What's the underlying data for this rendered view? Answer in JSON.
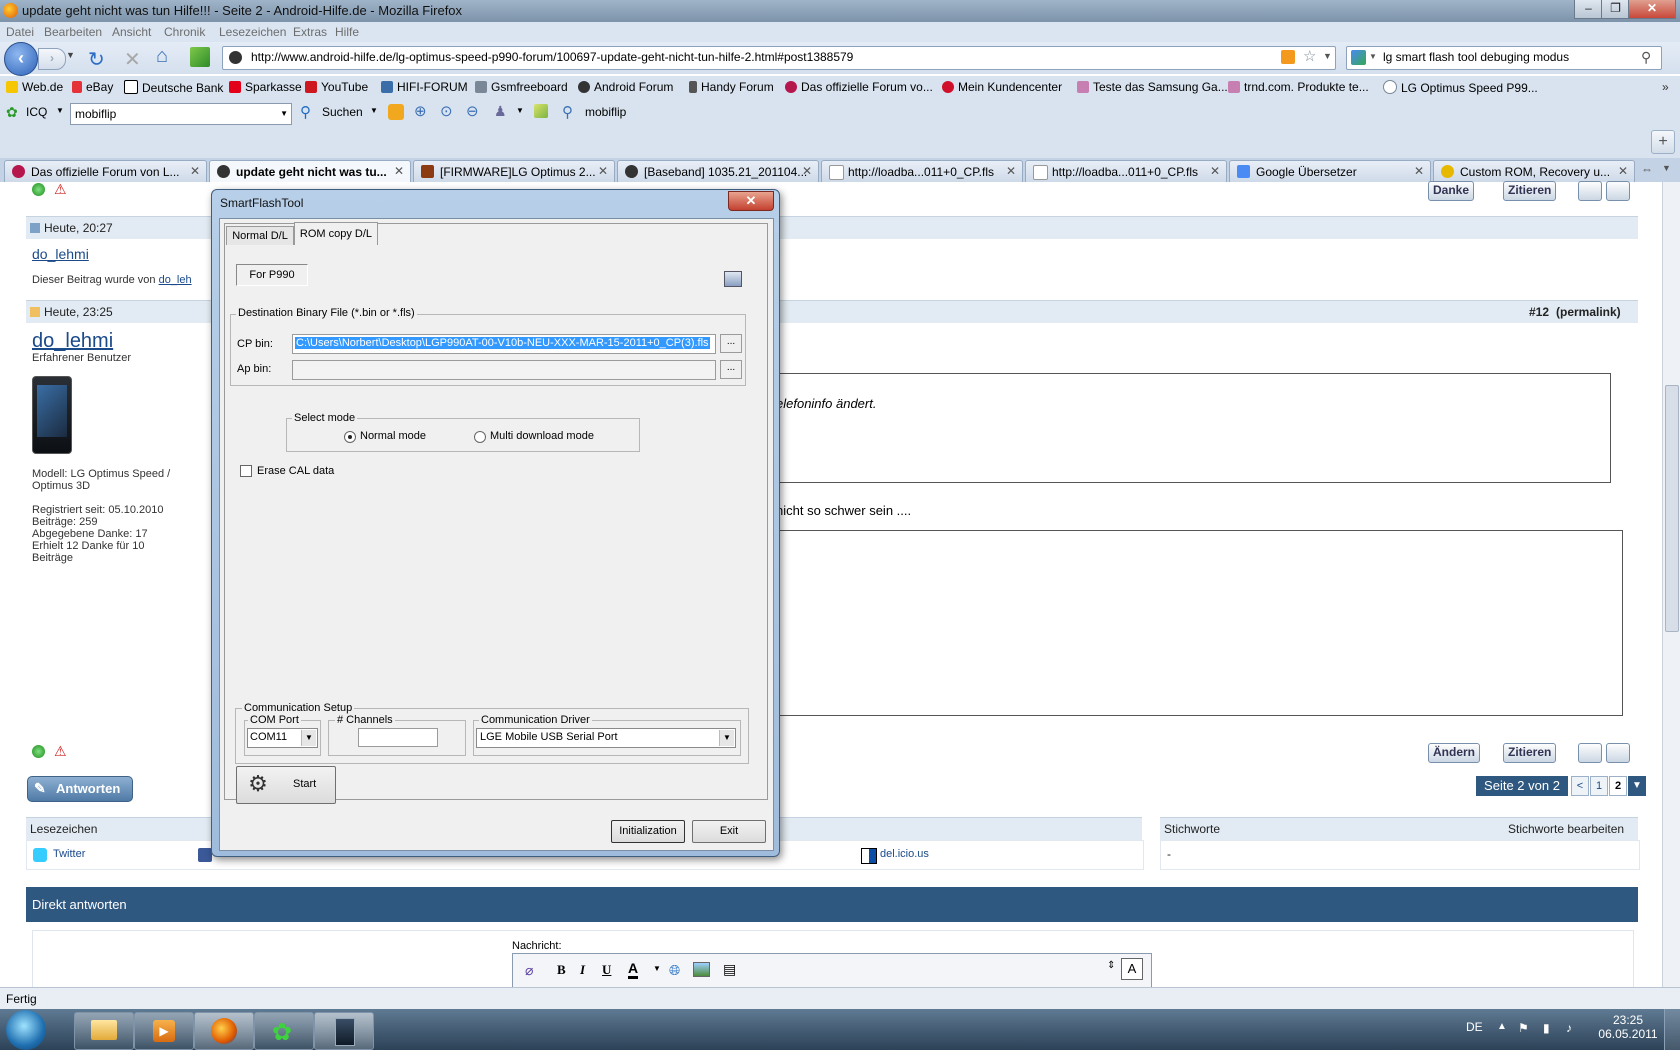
{
  "window": {
    "title": "update geht nicht was tun Hilfe!!! - Seite 2 - Android-Hilfe.de - Mozilla Firefox",
    "btn_min": "–",
    "btn_max": "❐",
    "btn_close": "✕"
  },
  "menu": [
    "Datei",
    "Bearbeiten",
    "Ansicht",
    "Chronik",
    "Lesezeichen",
    "Extras",
    "Hilfe"
  ],
  "nav": {
    "url": "http://www.android-hilfe.de/lg-optimus-speed-p990-forum/100697-update-geht-nicht-tun-hilfe-2.html#post1388579",
    "search": "lg smart flash tool debuging modus"
  },
  "bookmarks": [
    "Web.de",
    "eBay",
    "Deutsche Bank",
    "Sparkasse",
    "YouTube",
    "HIFI-FORUM",
    "Gsmfreeboard",
    "Android Forum",
    "Handy Forum",
    "Das offizielle Forum vo...",
    "Mein Kundencenter",
    "Teste das Samsung Ga...",
    "trnd.com. Produkte te...",
    "LG Optimus Speed P99..."
  ],
  "toolbar": {
    "icq": "ICQ",
    "icq_value": "mobiflip",
    "search_label": "Suchen",
    "mobiflip": "mobiflip"
  },
  "tabs": [
    {
      "label": "Das offizielle Forum von L...",
      "active": false
    },
    {
      "label": "update geht nicht was tu...",
      "active": true
    },
    {
      "label": "[FIRMWARE]LG Optimus 2...",
      "active": false
    },
    {
      "label": "[Baseband] 1035.21_201104...",
      "active": false
    },
    {
      "label": "http://loadba...011+0_CP.fls",
      "active": false
    },
    {
      "label": "http://loadba...011+0_CP.fls",
      "active": false
    },
    {
      "label": "Google Übersetzer",
      "active": false
    },
    {
      "label": "Custom ROM, Recovery u...",
      "active": false
    }
  ],
  "page": {
    "post1_date": "Heute, 20:27",
    "post1_user": "do_lehmi",
    "post1_note_prefix": "Dieser Beitrag wurde von",
    "post1_note_user": "do_leh",
    "post2_date": "Heute, 23:25",
    "post2_number": "#12",
    "post2_permalink": "(permalink)",
    "post2_user": "do_lehmi",
    "post2_rank": "Erfahrener Benutzer",
    "profile_model": "Modell: LG Optimus Speed /",
    "profile_model2": "Optimus 3D",
    "profile_reg": "Registriert seit: 05.10.2010",
    "profile_posts": "Beiträge: 259",
    "profile_thanks_given": "Abgegebene Danke: 17",
    "profile_thanks_got": "Erhielt 12 Danke für 10",
    "profile_thanks_got2": "Beiträge",
    "quote_text": "elefoninfo ändert.",
    "body_text": "nicht so schwer sein ....",
    "btn_danke": "Danke",
    "btn_zitieren": "Zitieren",
    "btn_andern": "Ändern",
    "btn_zitieren2": "Zitieren",
    "btn_antworten": "Antworten",
    "pager_label": "Seite 2 von 2",
    "pager_prev": "<",
    "pager_1": "1",
    "pager_2": "2",
    "lesezeichen": "Lesezeichen",
    "twitter": "Twitter",
    "delicious": "del.icio.us",
    "stichworte": "Stichworte",
    "stichworte_edit": "Stichworte bearbeiten",
    "stichworte_val": "-",
    "direkt": "Direkt antworten",
    "nachricht": "Nachricht:",
    "editor_bold": "B",
    "editor_italic": "I",
    "editor_underline": "U",
    "editor_color": "A"
  },
  "dialog": {
    "title": "SmartFlashTool",
    "close": "✕",
    "tab_normal": "Normal D/L",
    "tab_rom": "ROM copy D/L",
    "for_p990": "For P990",
    "dest_legend": "Destination Binary File (*.bin or *.fls)",
    "cp_label": "CP bin:",
    "cp_value": "C:\\Users\\Norbert\\Desktop\\LGP990AT-00-V10b-NEU-XXX-MAR-15-2011+0_CP(3).fls",
    "ap_label": "Ap bin:",
    "browse": "...",
    "select_mode": "Select mode",
    "mode_normal": "Normal mode",
    "mode_multi": "Multi download mode",
    "erase_cal": "Erase CAL data",
    "comm_setup": "Communication Setup",
    "com_port": "COM Port",
    "com_value": "COM11",
    "channels": "# Channels",
    "driver": "Communication Driver",
    "driver_value": "LGE Mobile USB Serial Port",
    "start": "Start",
    "init": "Initialization",
    "exit": "Exit"
  },
  "status": "Fertig",
  "tray": {
    "lang": "DE",
    "time": "23:25",
    "date": "06.05.2011"
  },
  "colors": {
    "dir_bar": "#2f5880",
    "link": "#1a4a8a",
    "selection": "#3399ff"
  }
}
